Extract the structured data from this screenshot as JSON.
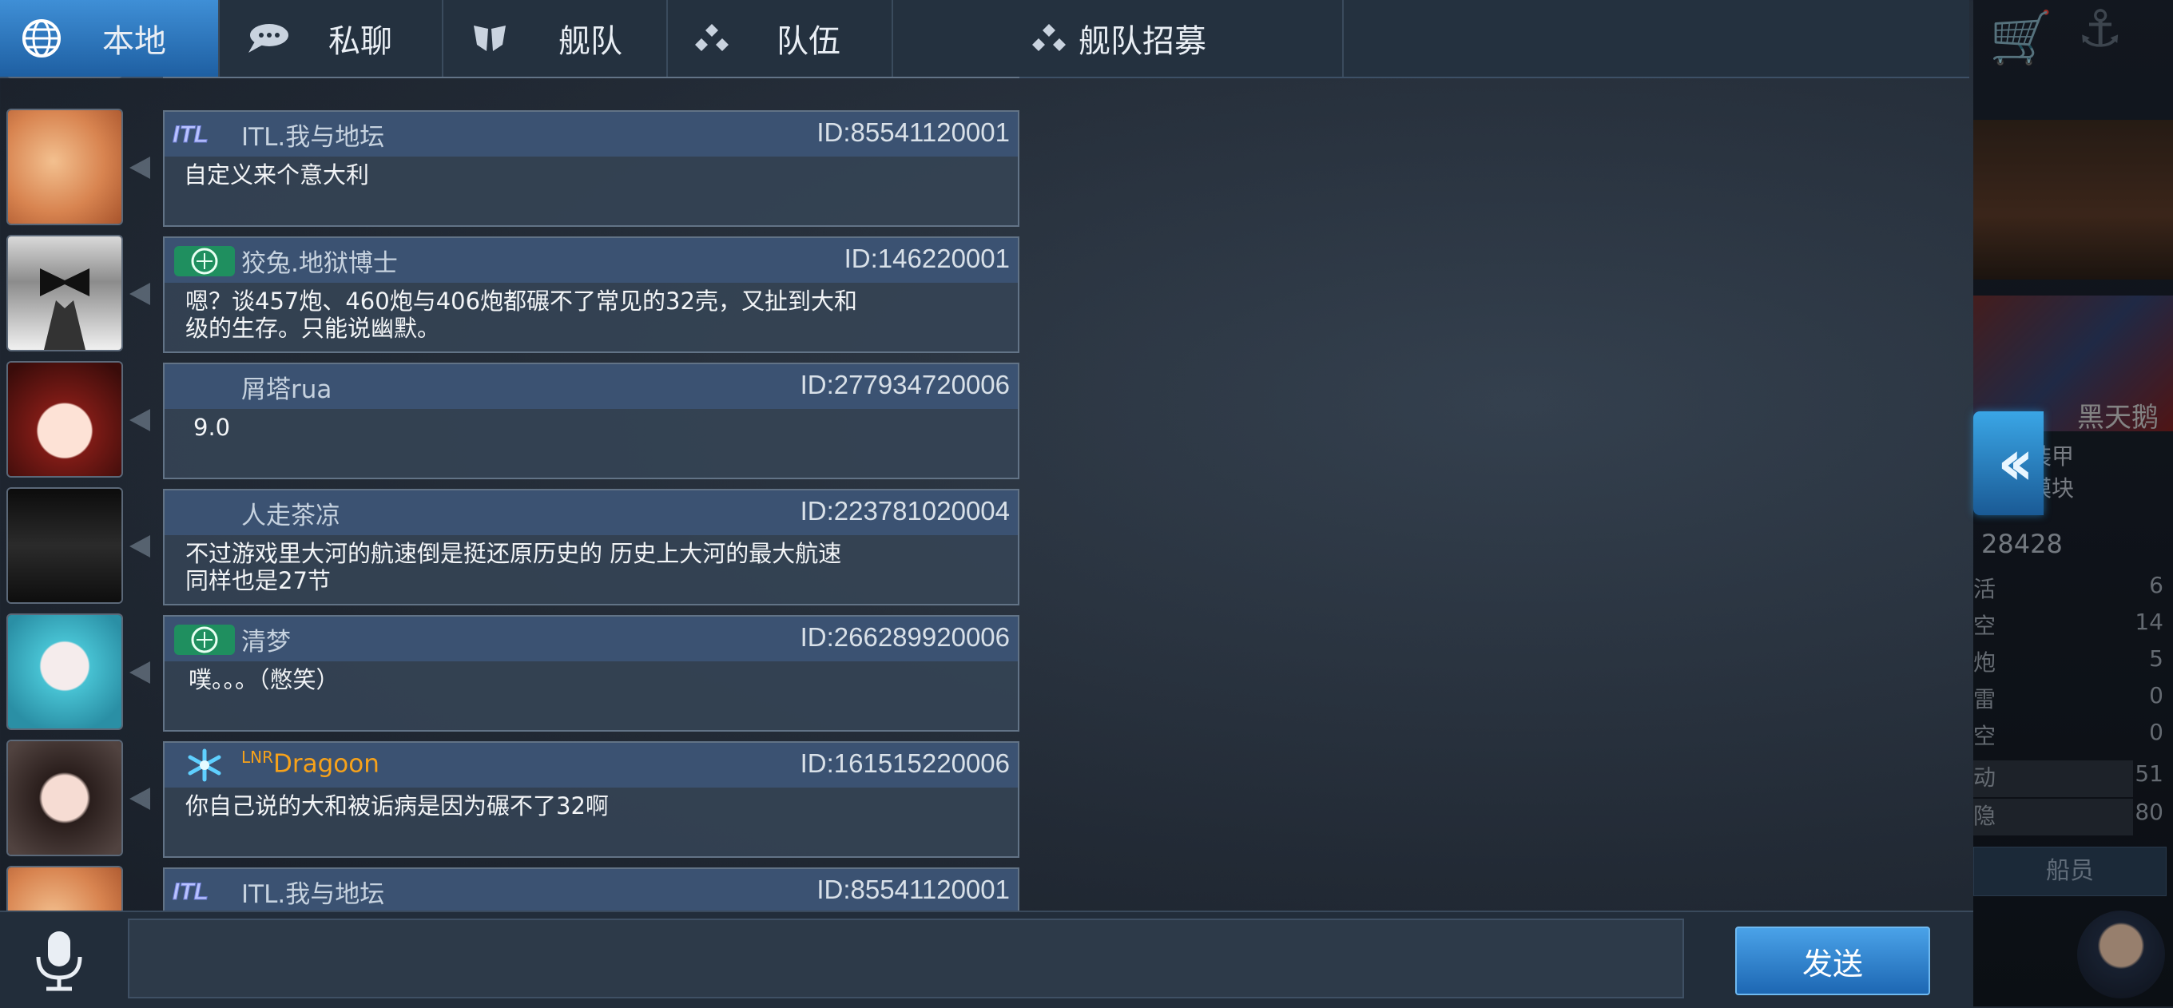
{
  "tabs": [
    {
      "label": "本地",
      "icon": "globe-icon",
      "active": true
    },
    {
      "label": "私聊",
      "icon": "speech-bubble-icon",
      "active": false
    },
    {
      "label": "舰队",
      "icon": "fleet-shield-icon",
      "active": false
    },
    {
      "label": "队伍",
      "icon": "team-dots-icon",
      "active": false
    },
    {
      "label": "舰队招募",
      "icon": "team-dots-icon",
      "active": false
    }
  ],
  "messages": [
    {
      "name": "ITL.我与地坛",
      "id": "ID:85541120001",
      "text": "自定义来个意大利",
      "badge": "ITL"
    },
    {
      "name": "狡兔.地狱博士",
      "id": "ID:146220001",
      "text": "嗯？谈457炮、460炮与406炮都碾不了常见的32壳，又扯到大和\n级的生存。只能说幽默。",
      "badge": "TEXT_1"
    },
    {
      "name": "屑塔rua",
      "id": "ID:277934720006",
      "text": "9.0",
      "badge": ""
    },
    {
      "name": "人走茶凉",
      "id": "ID:223781020004",
      "text": "不过游戏里大河的航速倒是挺还原历史的 历史上大河的最大航速\n同样也是27节",
      "badge": ""
    },
    {
      "name": "清梦",
      "id": "ID:266289920006",
      "text": "噗。。。（憋笑）",
      "badge": "TEXT_1"
    },
    {
      "name": "Dragoon",
      "name_prefix": "LNR",
      "id": "ID:161515220006",
      "text": "你自己说的大和被诟病是因为碾不了32啊",
      "badge": "snow"
    },
    {
      "name": "ITL.我与地坛",
      "id": "ID:85541120001",
      "text": "",
      "badge": "ITL"
    }
  ],
  "input": {
    "placeholder": ""
  },
  "send_label": "发送",
  "side": {
    "ship_name": "黑天鹅",
    "tabs": [
      "装甲",
      "模块"
    ],
    "main_stat": "28428",
    "stats": [
      {
        "k": "活",
        "v": "6"
      },
      {
        "k": "空",
        "v": "14"
      },
      {
        "k": "炮",
        "v": "5"
      },
      {
        "k": "雷",
        "v": "0"
      },
      {
        "k": "空",
        "v": "0"
      },
      {
        "k": "动",
        "v": "51"
      },
      {
        "k": "隐",
        "v": "80"
      }
    ],
    "crew_label": "船员"
  },
  "colors": {
    "accent": "#2f7fcc",
    "panel": "#364455",
    "header": "#3b5272"
  }
}
